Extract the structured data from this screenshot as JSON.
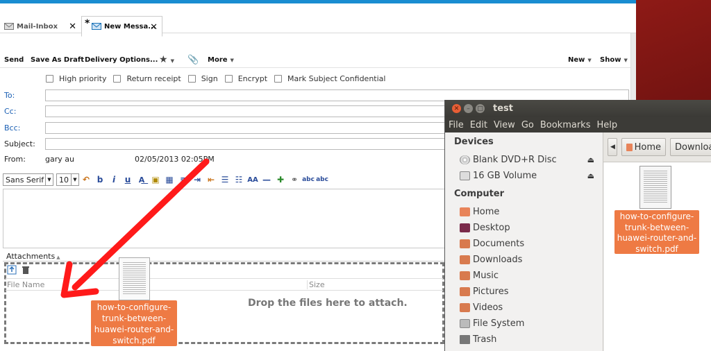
{
  "mail": {
    "tabs": [
      {
        "label": "Mail-Inbox",
        "close": "✕"
      },
      {
        "label": "New Messa...",
        "modified": "*",
        "close": "✕"
      }
    ],
    "toolbar": {
      "send": "Send",
      "save_draft": "Save As Draft",
      "delivery": "Delivery Options...",
      "more": "More",
      "new": "New",
      "show": "Show"
    },
    "options": [
      "High priority",
      "Return receipt",
      "Sign",
      "Encrypt",
      "Mark Subject Confidential"
    ],
    "fields": {
      "to": "To:",
      "cc": "Cc:",
      "bcc": "Bcc:",
      "subject": "Subject:",
      "from": "From:",
      "from_value": "gary au",
      "date_value": "02/05/2013 02:05PM"
    },
    "format": {
      "font": "Sans Serif",
      "size": "10"
    },
    "attachments": {
      "label": "Attachments",
      "col_name": "File Name",
      "col_size": "Size",
      "drop_text": "Drop the files here to attach."
    },
    "dragged_file": "how-to-configure-trunk-between-huawei-router-and-switch.pdf"
  },
  "fm": {
    "title": "test",
    "menu": [
      "File",
      "Edit",
      "View",
      "Go",
      "Bookmarks",
      "Help"
    ],
    "devices_header": "Devices",
    "devices": [
      "Blank DVD+R Disc",
      "16 GB Volume"
    ],
    "computer_header": "Computer",
    "places": [
      "Home",
      "Desktop",
      "Documents",
      "Downloads",
      "Music",
      "Pictures",
      "Videos",
      "File System",
      "Trash"
    ],
    "path": {
      "home": "Home",
      "downloads": "Downloads"
    },
    "file": "how-to-configure-trunk-between-huawei-router-and-switch.pdf"
  },
  "colors": {
    "accent": "#1a8dd1",
    "label_blue": "#1a5fb4",
    "selection_orange": "#ee7a44",
    "arrow_red": "#ff1a1a"
  }
}
